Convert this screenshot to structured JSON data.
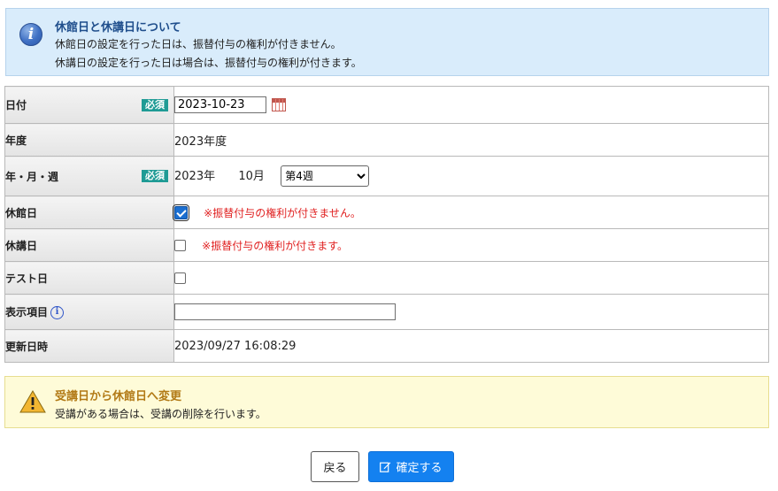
{
  "info": {
    "title": "休館日と休講日について",
    "line1": "休館日の設定を行った日は、振替付与の権利が付きません。",
    "line2": "休講日の設定を行った日は場合は、振替付与の権利が付きます。",
    "icon": "info-icon"
  },
  "form": {
    "required_label": "必須",
    "date": {
      "label": "日付",
      "value": "2023-10-23",
      "icon": "calendar-icon"
    },
    "fiscal_year": {
      "label": "年度",
      "value": "2023年度"
    },
    "year_month_week": {
      "label": "年・月・週",
      "year": "2023年",
      "month": "10月",
      "week_selected": "第4週"
    },
    "closed_day": {
      "label": "休館日",
      "checked": true,
      "note": "※振替付与の権利が付きません。"
    },
    "no_class_day": {
      "label": "休講日",
      "checked": false,
      "note": "※振替付与の権利が付きます。"
    },
    "test_day": {
      "label": "テスト日",
      "checked": false
    },
    "display_item": {
      "label": "表示項目",
      "value": "",
      "icon": "help-icon"
    },
    "updated_at": {
      "label": "更新日時",
      "value": "2023/09/27 16:08:29"
    }
  },
  "alert": {
    "title": "受講日から休館日へ変更",
    "text": "受講がある場合は、受講の削除を行います。",
    "icon": "warning-icon"
  },
  "buttons": {
    "back": "戻る",
    "confirm": "確定する",
    "confirm_icon": "edit-icon"
  },
  "colors": {
    "info_bg": "#d9ecfb",
    "required_badge": "#1f9b95",
    "warning_text": "#e02020",
    "alert_bg": "#fefbd8",
    "primary_button": "#1481f0"
  }
}
